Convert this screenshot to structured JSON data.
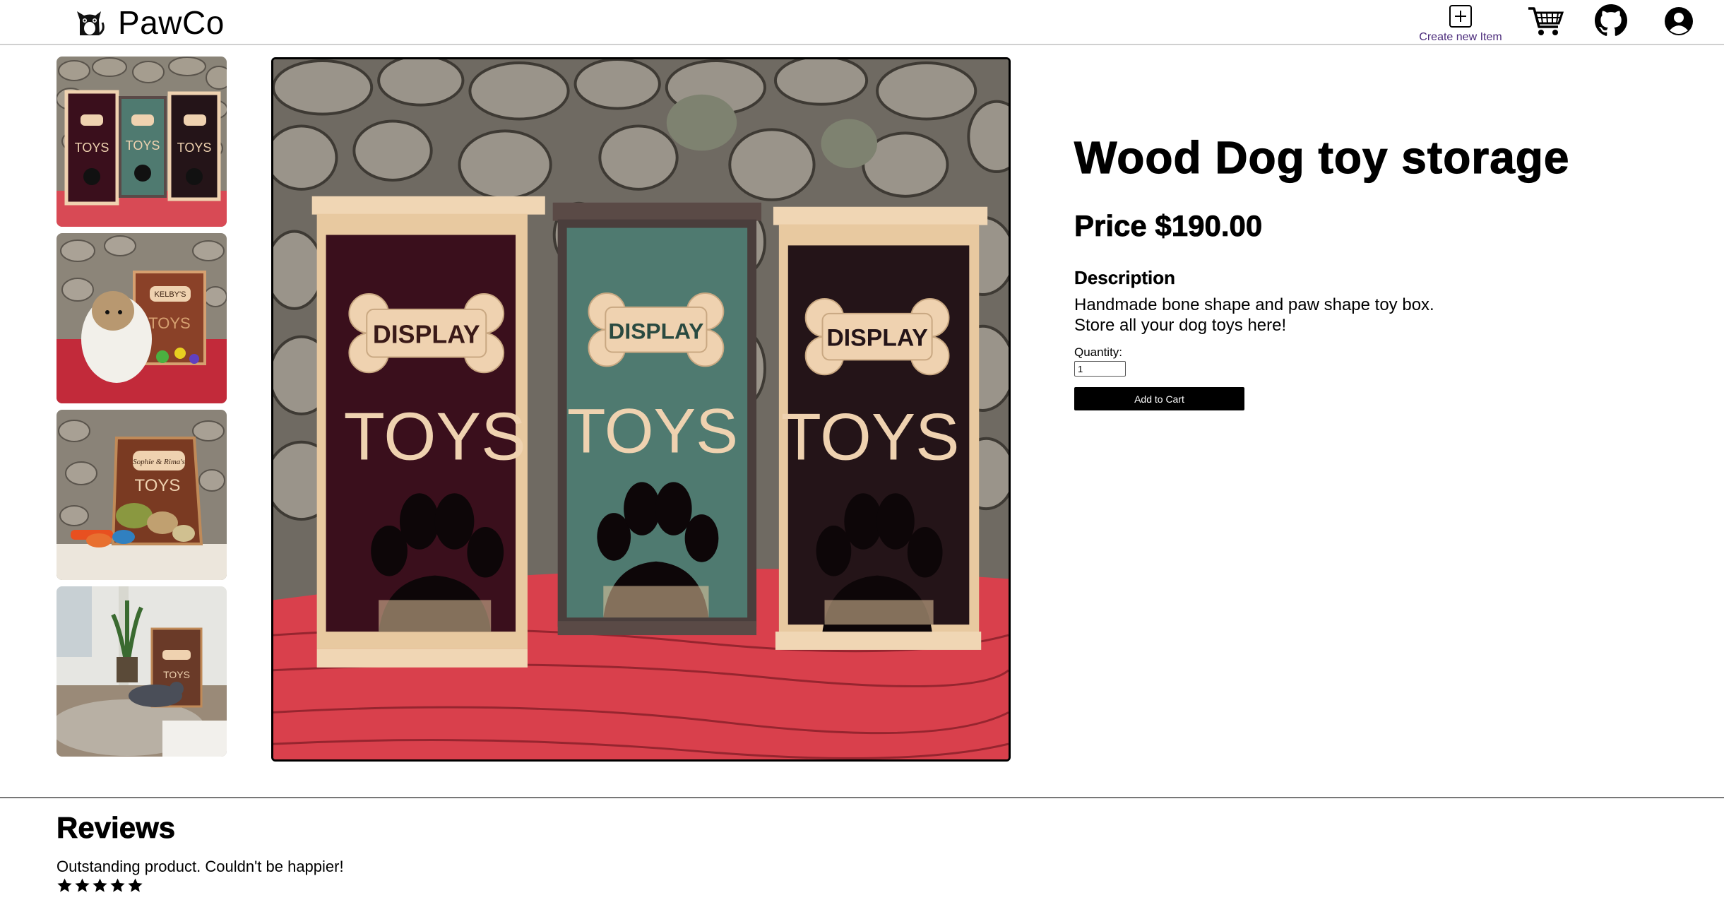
{
  "brand": {
    "name": "PawCo",
    "logo_icon": "cat-icon"
  },
  "header": {
    "create_item_label": "Create new Item",
    "icons": [
      "plus-square-icon",
      "cart-icon",
      "github-icon",
      "account-icon"
    ]
  },
  "gallery": {
    "thumbnails": [
      {
        "title": "Three toy storage boxes"
      },
      {
        "title": "Dog with KELBY'S toy box",
        "text": "KELBY'S"
      },
      {
        "title": "Personalized toy box with toys",
        "text": "Sophie & Rima's"
      },
      {
        "title": "Toy box in living room"
      }
    ],
    "main_image_title": "Three DISPLAY TOYS storage boxes",
    "box_text_top": "DISPLAY",
    "box_text_bottom": "TOYS"
  },
  "product": {
    "title": "Wood Dog toy storage",
    "price": "Price $190.00",
    "description_heading": "Description",
    "description": "Handmade bone shape and paw shape toy box. Store all your dog toys here!",
    "quantity_label": "Quantity:",
    "quantity_value": "1",
    "add_to_cart_label": "Add to Cart"
  },
  "reviews": {
    "title": "Reviews",
    "items": [
      {
        "text": "Outstanding product. Couldn't be happier!",
        "rating": 5
      }
    ]
  },
  "colors": {
    "box_maroon": "#3a0f1c",
    "box_teal": "#4f7a70",
    "box_dark": "#241418",
    "wood": "#efd2b0",
    "table_red": "#d9404c",
    "accent_purple": "#4a2a7a"
  }
}
